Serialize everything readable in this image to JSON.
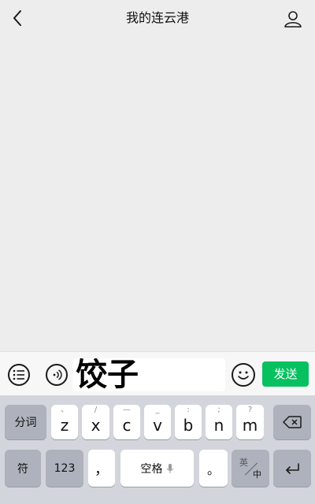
{
  "header": {
    "title": "我的连云港"
  },
  "input_bar": {
    "text": "饺子",
    "send_label": "发送"
  },
  "keyboard": {
    "row1": [
      {
        "label": "分词",
        "type": "function"
      },
      {
        "label": "z",
        "hint": "、"
      },
      {
        "label": "x",
        "hint": "/"
      },
      {
        "label": "c",
        "hint": "—"
      },
      {
        "label": "v",
        "hint": "_"
      },
      {
        "label": "b",
        "hint": ":"
      },
      {
        "label": "n",
        "hint": ";"
      },
      {
        "label": "m",
        "hint": "?"
      }
    ],
    "row2": {
      "symbol": "符",
      "numbers": "123",
      "comma": "，",
      "space": "空格",
      "period": "。",
      "lang_en": "英",
      "lang_zh": "中"
    }
  }
}
